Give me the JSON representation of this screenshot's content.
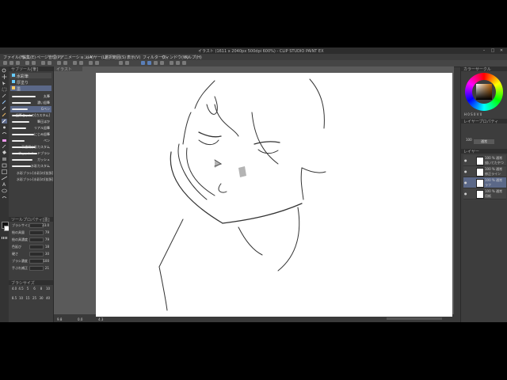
{
  "title": "イラスト (1611 x 2040px 500dpi 600%)  - CLIP STUDIO PAINT EX",
  "window_controls": [
    "–",
    "□",
    "✕"
  ],
  "menu": [
    "ファイル(F)",
    "編集(E)",
    "ページ管理(P)",
    "アニメーション(A)",
    "レイヤー(L)",
    "選択範囲(S)",
    "表示(V)",
    "フィルター(I)",
    "ウィンドウ(W)",
    "ヘルプ(H)"
  ],
  "canvas_tab": "イラスト",
  "subtool": {
    "header": "サブツール[筆]",
    "groups": [
      "水彩筆",
      "厚塗り",
      "墨"
    ],
    "selected_group": "墨",
    "brushes": [
      {
        "name": "丸筆",
        "width": 30
      },
      {
        "name": "濃い鉛筆",
        "width": 24
      },
      {
        "name": "Gペン",
        "width": 20
      },
      {
        "name": "鉛筆セットの[カスタム]",
        "width": 26
      },
      {
        "name": "筆圧ほか",
        "width": 22
      },
      {
        "name": "リアル鉛筆",
        "width": 18
      },
      {
        "name": "にじみ鉛筆",
        "width": 28
      },
      {
        "name": "ペン",
        "width": 16
      },
      {
        "name": "不透明水彩カスタム",
        "width": 30
      },
      {
        "name": "ウェットハードブラシ",
        "width": 32
      },
      {
        "name": "ガッシュ",
        "width": 26
      },
      {
        "name": "水彩カスタム",
        "width": 24
      }
    ],
    "extra": [
      "水彩ブラシ[水彩]の[拡張]",
      "水彩ブラシ[水彩]の[拡張]"
    ]
  },
  "tool_property": {
    "header": "ツールプロパティ[墨]",
    "rows": [
      {
        "label": "ブラシサイズ",
        "value": "23.0"
      },
      {
        "label": "絵の具量",
        "value": "79"
      },
      {
        "label": "絵の具濃度",
        "value": "79"
      },
      {
        "label": "色延び",
        "value": "18"
      },
      {
        "label": "硬さ",
        "value": "30"
      },
      {
        "label": "ブラシ濃度",
        "value": "100"
      },
      {
        "label": "手ぶれ補正",
        "value": "21"
      }
    ]
  },
  "brush_size": {
    "header": "ブラシサイズ",
    "values": [
      "4.0",
      "4.5",
      "5",
      "6",
      "8",
      "10",
      "8.5",
      "10",
      "15",
      "25",
      "30",
      "40"
    ]
  },
  "color_wheel": {
    "header": "カラーサークル",
    "hsv": "H 0 S 0 V 0"
  },
  "layer_property": {
    "header": "レイヤープロパティ",
    "blend": "通常",
    "opacity": "100"
  },
  "layer_panel": {
    "header": "レイヤー",
    "layers": [
      {
        "pct": "100 % 通常",
        "name": "描いてたやつ",
        "selected": false
      },
      {
        "pct": "100 % 通常",
        "name": "修正ライン",
        "selected": false
      },
      {
        "pct": "100 % 通常",
        "name": "ラフ",
        "selected": true
      },
      {
        "pct": "100 % 通常",
        "name": "用紙",
        "selected": false
      }
    ]
  },
  "status": {
    "zoom": "9.8",
    "angle": "0.0",
    "coords": "4.3"
  }
}
